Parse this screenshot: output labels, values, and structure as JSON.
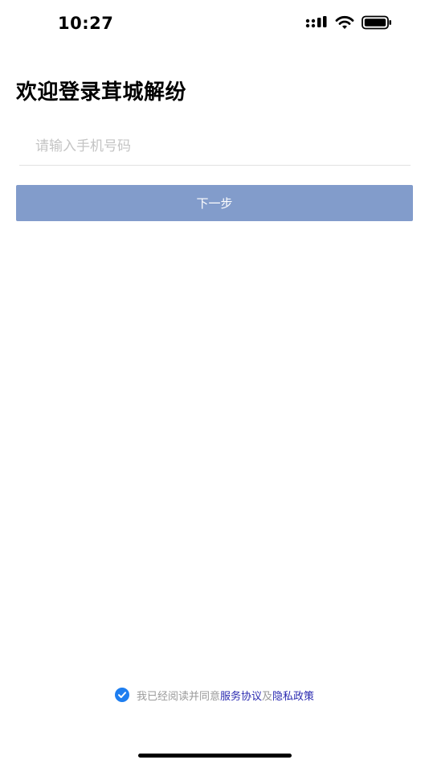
{
  "status_bar": {
    "time": "10:27",
    "icons": [
      "cellular-signal-icon",
      "wifi-icon",
      "battery-icon"
    ]
  },
  "page": {
    "title": "欢迎登录茸城解纷"
  },
  "phone_input": {
    "placeholder": "请输入手机号码",
    "value": ""
  },
  "next_button": {
    "label": "下一步"
  },
  "agreement": {
    "checked": true,
    "prefix": "我已经阅读并同意",
    "service_link": "服务协议",
    "conjunction": "及",
    "privacy_link": "隐私政策"
  },
  "colors": {
    "button_bg": "#829ccb",
    "checkbox": "#1e7ef0",
    "link": "#2a2ab0",
    "placeholder": "#c4c4c4"
  }
}
